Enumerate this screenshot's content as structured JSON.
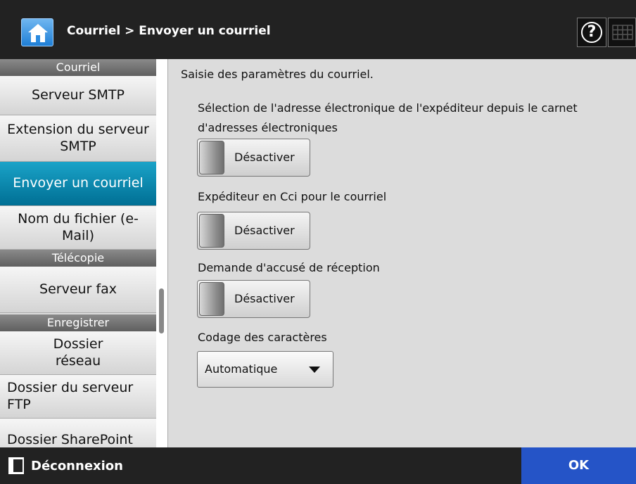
{
  "header": {
    "breadcrumb": "Courriel > Envoyer un courriel",
    "icons": {
      "home": "home-icon",
      "help": "help-icon",
      "keyboard": "keyboard-icon"
    }
  },
  "sidebar": {
    "sections": [
      {
        "title": "Courriel"
      },
      {
        "title": "Télécopie"
      },
      {
        "title": "Enregistrer"
      }
    ],
    "items": [
      {
        "label": "Serveur SMTP"
      },
      {
        "label": "Extension du serveur SMTP"
      },
      {
        "label": "Envoyer un courriel",
        "active": true
      },
      {
        "label": "Nom du fichier (e-Mail)"
      },
      {
        "label": "Serveur fax"
      },
      {
        "label": "Dossier réseau"
      },
      {
        "label": "Dossier du serveur FTP"
      },
      {
        "label": "Dossier SharePoint"
      }
    ]
  },
  "main": {
    "title": "Saisie des paramètres du courriel.",
    "fields": [
      {
        "label": "Sélection de l'adresse électronique de l'expéditeur depuis le carnet d'adresses électroniques",
        "toggle": "Désactiver"
      },
      {
        "label": "Expéditeur en Cci pour le courriel",
        "toggle": "Désactiver"
      },
      {
        "label": "Demande d'accusé de réception",
        "toggle": "Désactiver"
      }
    ],
    "encoding": {
      "label": "Codage des caractères",
      "value": "Automatique"
    }
  },
  "footer": {
    "logout_label": "Déconnexion",
    "ok_label": "OK"
  },
  "colors": {
    "header_bg": "#222222",
    "active_item": "#0a86ad",
    "ok_button": "#2554c7",
    "panel_bg": "#dcdcdc"
  }
}
